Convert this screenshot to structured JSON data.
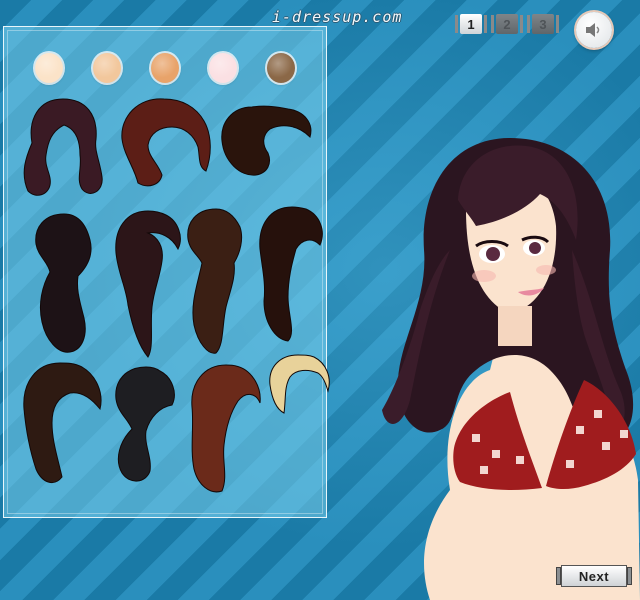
{
  "brand": {
    "site_name": "i-dressup.com"
  },
  "pagination": {
    "pages": [
      {
        "label": "1",
        "active": true
      },
      {
        "label": "2",
        "active": false
      },
      {
        "label": "3",
        "active": false
      }
    ]
  },
  "sound": {
    "icon": "speaker-icon"
  },
  "skin_swatches": {
    "colors": [
      "#fbe3c8",
      "#f2c79c",
      "#e8a36a",
      "#fbe0e3",
      "#8b6847"
    ]
  },
  "hairstyles": {
    "colors": [
      "#3a1a24",
      "#5c1e16",
      "#2a140c",
      "#1d1216",
      "#2c1518",
      "#3b1f14",
      "#26110c",
      "#2e1a12",
      "#1e1e22",
      "#6b2a1a",
      "#e8d29a"
    ]
  },
  "footer": {
    "next_label": "Next"
  },
  "colors": {
    "stripe_dark": "#1a7aa6",
    "stripe_light": "#2a8fbd",
    "hair_main": "#2b1520",
    "top_red": "#a01c1e",
    "skin": "#fbe3ce"
  }
}
